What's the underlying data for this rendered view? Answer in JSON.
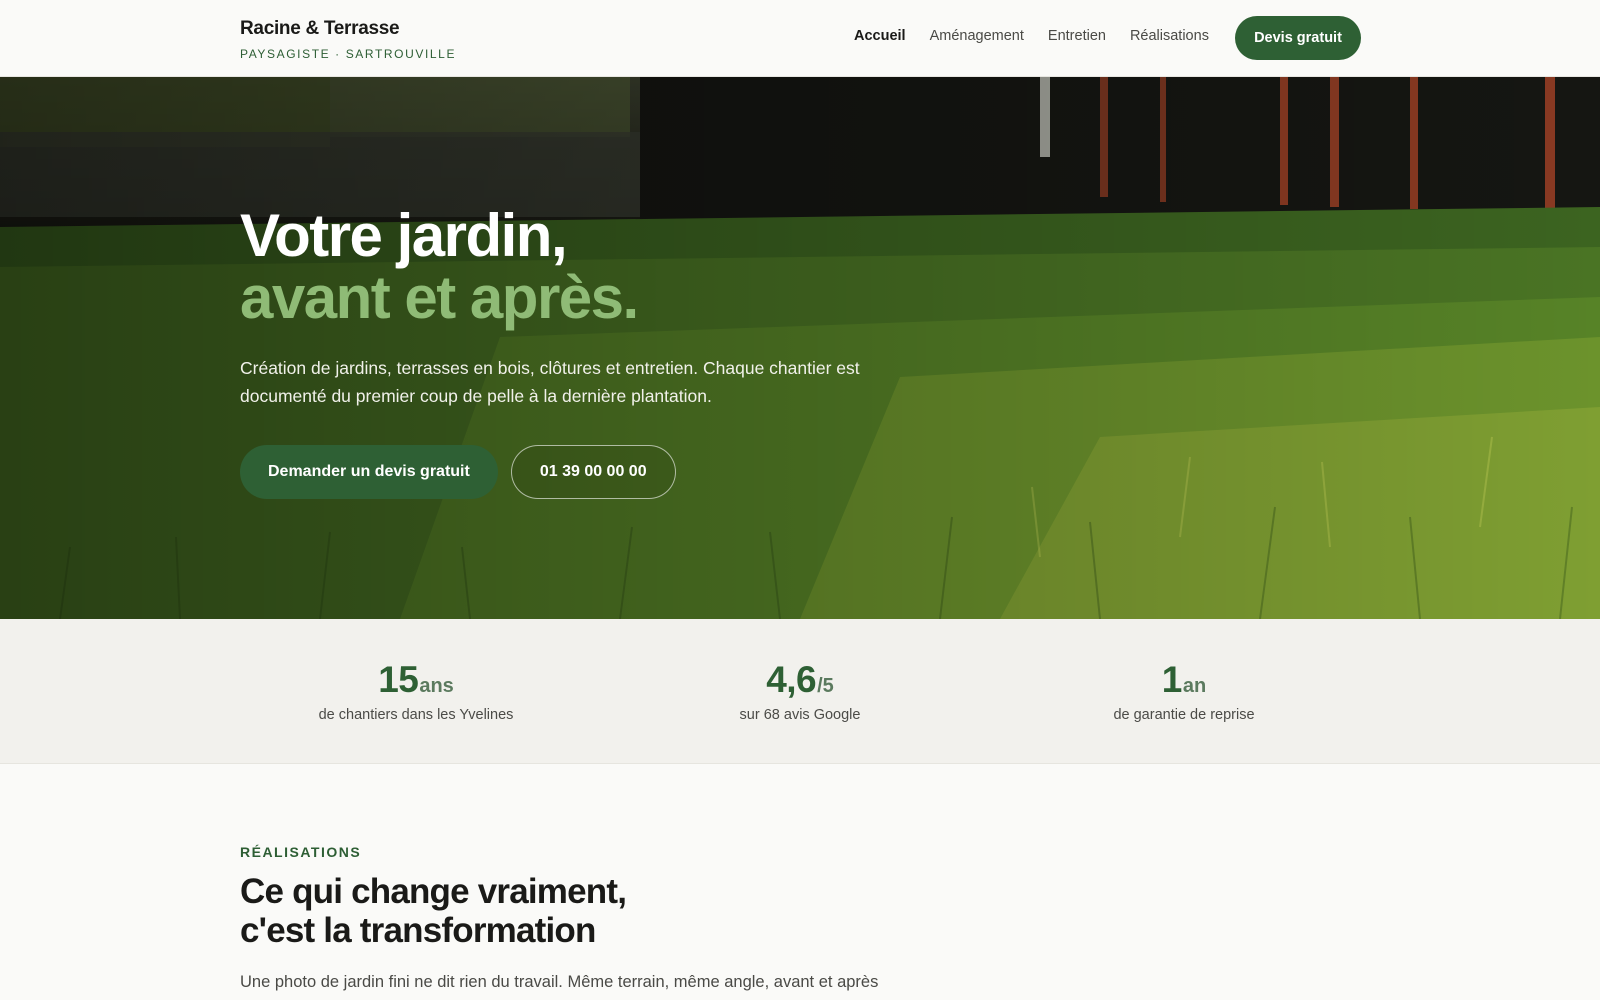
{
  "header": {
    "brand_name": "Racine & Terrasse",
    "brand_sub": "PAYSAGISTE · SARTROUVILLE",
    "nav": [
      {
        "label": "Accueil",
        "active": true
      },
      {
        "label": "Aménagement",
        "active": false
      },
      {
        "label": "Entretien",
        "active": false
      },
      {
        "label": "Réalisations",
        "active": false
      }
    ],
    "cta": "Devis gratuit"
  },
  "hero": {
    "title_line1": "Votre jardin,",
    "title_line2": "avant et après.",
    "text": "Création de jardins, terrasses en bois, clôtures et entretien. Chaque chantier est documenté du premier coup de pelle à la dernière plantation.",
    "primary_button": "Demander un devis gratuit",
    "phone_button": "01 39 00 00 00",
    "image": "photo-lawn-closeup"
  },
  "stats": [
    {
      "value": "15",
      "unit": "ans",
      "label": "de chantiers dans les Yvelines"
    },
    {
      "value": "4,6",
      "unit": "/5",
      "label": "sur 68 avis Google"
    },
    {
      "value": "1",
      "unit": "an",
      "label": "de garantie de reprise"
    }
  ],
  "realisations": {
    "eyebrow": "RÉALISATIONS",
    "title_line1": "Ce qui change vraiment,",
    "title_line2": "c'est la transformation",
    "text": "Une photo de jardin fini ne dit rien du travail. Même terrain, même angle, avant et après"
  },
  "colors": {
    "brand_green": "#2e6034",
    "accent_light_green": "#8fbb76",
    "background": "#fafaf8",
    "stats_background": "#f2f1ed"
  }
}
